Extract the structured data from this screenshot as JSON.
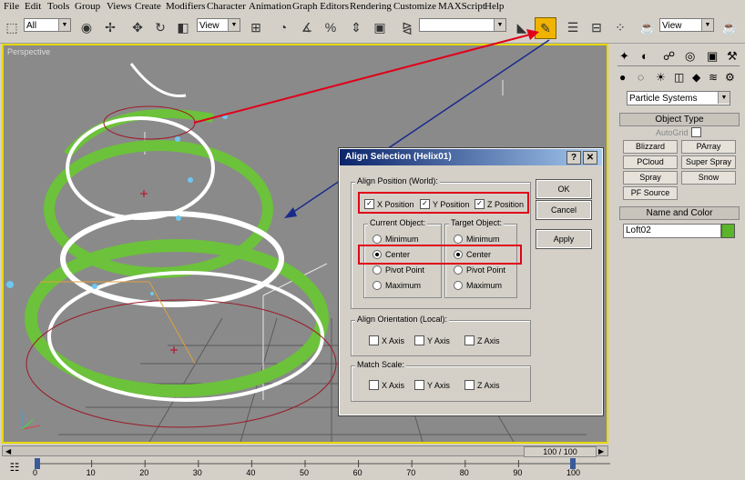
{
  "menu": [
    "File",
    "Edit",
    "Tools",
    "Group",
    "Views",
    "Create",
    "Modifiers",
    "Character",
    "Animation",
    "Graph Editors",
    "Rendering",
    "Customize",
    "MAXScript",
    "Help"
  ],
  "toolbar": {
    "selection_filter": "All",
    "ref_coord": "View",
    "named_selection": "",
    "right_combo": "View"
  },
  "viewport": {
    "label": "Perspective"
  },
  "command_panel": {
    "category": "Particle Systems",
    "object_type_title": "Object Type",
    "autogrid": "AutoGrid",
    "buttons": [
      "Blizzard",
      "PArray",
      "PCloud",
      "Super Spray",
      "Spray",
      "Snow",
      "PF Source"
    ],
    "name_color_title": "Name and Color",
    "object_name": "Loft02",
    "object_color": "#5ab52a"
  },
  "dialog": {
    "title": "Align Selection (Helix01)",
    "align_position": "Align Position (World):",
    "x_position": "X Position",
    "y_position": "Y Position",
    "z_position": "Z Position",
    "current_object": "Current Object:",
    "target_object": "Target Object:",
    "options": [
      "Minimum",
      "Center",
      "Pivot Point",
      "Maximum"
    ],
    "current_selected": "Center",
    "target_selected": "Center",
    "align_orientation": "Align Orientation (Local):",
    "match_scale": "Match Scale:",
    "x_axis": "X Axis",
    "y_axis": "Y Axis",
    "z_axis": "Z Axis",
    "ok": "OK",
    "cancel": "Cancel",
    "apply": "Apply"
  },
  "timeline": {
    "frame": "100 / 100",
    "ticks": [
      "0",
      "10",
      "20",
      "30",
      "40",
      "50",
      "60",
      "70",
      "80",
      "90",
      "100"
    ]
  },
  "colors": {
    "annotation_red": "#e0001a",
    "annotation_blue": "#1a2a8c",
    "viewport_border": "#e8d800",
    "helix_green": "#6cc23a"
  }
}
